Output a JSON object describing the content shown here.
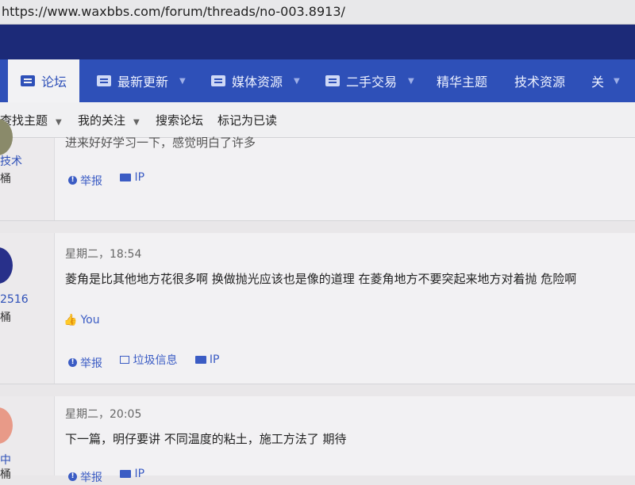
{
  "browser": {
    "url": "https://www.waxbbs.com/forum/threads/no-003.8913/"
  },
  "nav": {
    "items": [
      {
        "label": "论坛",
        "icon": "chat-icon",
        "active": true
      },
      {
        "label": "最新更新",
        "icon": "alert-icon"
      },
      {
        "label": "媒体资源",
        "icon": "image-icon"
      },
      {
        "label": "二手交易",
        "icon": "tag-icon"
      },
      {
        "label": "精华主题"
      },
      {
        "label": "技术资源"
      },
      {
        "label": "关"
      }
    ]
  },
  "subnav": {
    "items": [
      "查找主题",
      "我的关注",
      "搜索论坛",
      "标记为已读"
    ]
  },
  "posts": [
    {
      "user": "技术",
      "group": "桶",
      "text": "进来好好学习一下，感觉明白了许多",
      "actions": [
        "举报",
        "IP"
      ]
    },
    {
      "user": "2516",
      "group": "桶",
      "time": "星期二，18:54",
      "text": "菱角是比其他地方花很多啊 换做抛光应该也是像的道理 在菱角地方不要突起来地方对着抛 危险啊",
      "like": "You",
      "actions": [
        "举报",
        "垃圾信息",
        "IP"
      ]
    },
    {
      "user": "中",
      "group": "桶",
      "time": "星期二，20:05",
      "text": "下一篇，明仔要讲 不同温度的粘土，施工方法了 期待",
      "actions": [
        "举报",
        "IP"
      ]
    }
  ],
  "colors": {
    "nav": "#2e50b8",
    "banner": "#1c2a78",
    "link": "#3b5cc4"
  }
}
